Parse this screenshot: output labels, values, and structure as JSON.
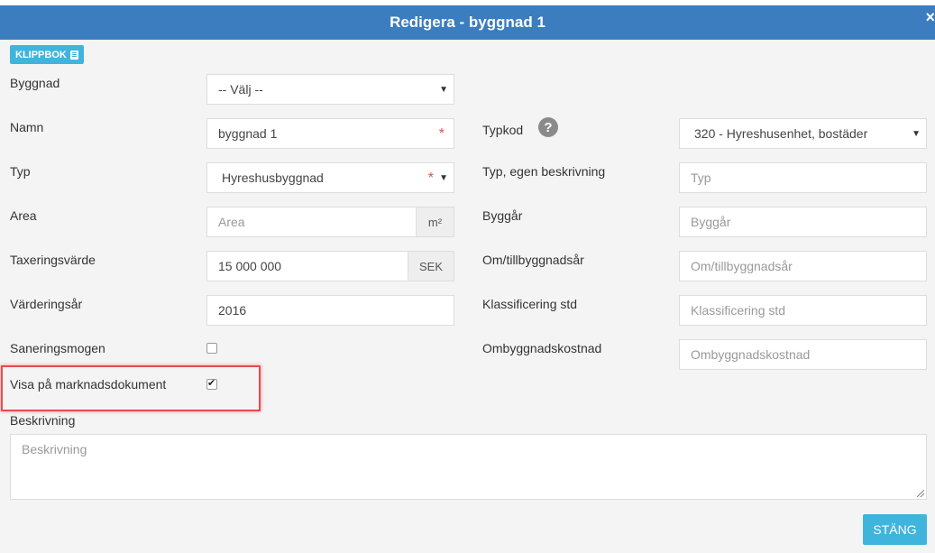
{
  "modal": {
    "title": "Redigera - byggnad 1",
    "close": "×"
  },
  "toolbar": {
    "clipboard_label": "KLIPPBOK"
  },
  "form": {
    "byggnad": {
      "label": "Byggnad",
      "value": "-- Välj --"
    },
    "namn": {
      "label": "Namn",
      "value": "byggnad 1",
      "required": "*"
    },
    "typ": {
      "label": "Typ",
      "value": "Hyreshusbyggnad",
      "required": "*"
    },
    "area": {
      "label": "Area",
      "placeholder": "Area",
      "unit": "m²"
    },
    "taxeringsvarde": {
      "label": "Taxeringsvärde",
      "value": "15 000 000",
      "unit": "SEK"
    },
    "varderingsar": {
      "label": "Värderingsår",
      "value": "2016"
    },
    "saneringsmogen": {
      "label": "Saneringsmogen",
      "checked": false
    },
    "visa_marknadsdokument": {
      "label": "Visa på marknadsdokument",
      "checked": true
    },
    "typkod": {
      "label": "Typkod",
      "help": "?",
      "value": "320 - Hyreshusenhet, bostäder"
    },
    "typ_egen": {
      "label": "Typ, egen beskrivning",
      "placeholder": "Typ"
    },
    "byggar": {
      "label": "Byggår",
      "placeholder": "Byggår"
    },
    "om_tillbyggnadsar": {
      "label": "Om/tillbyggnadsår",
      "placeholder": "Om/tillbyggnadsår"
    },
    "klassificering": {
      "label": "Klassificering std",
      "placeholder": "Klassificering std"
    },
    "ombyggnadskostnad": {
      "label": "Ombyggnadskostnad",
      "placeholder": "Ombyggnadskostnad"
    },
    "beskrivning": {
      "label": "Beskrivning",
      "placeholder": "Beskrivning"
    }
  },
  "footer": {
    "close_label": "STÄNG"
  },
  "colors": {
    "header": "#3b7dbf",
    "button": "#3fb5dd",
    "highlight": "#e84a4f",
    "required": "#d9534f"
  }
}
